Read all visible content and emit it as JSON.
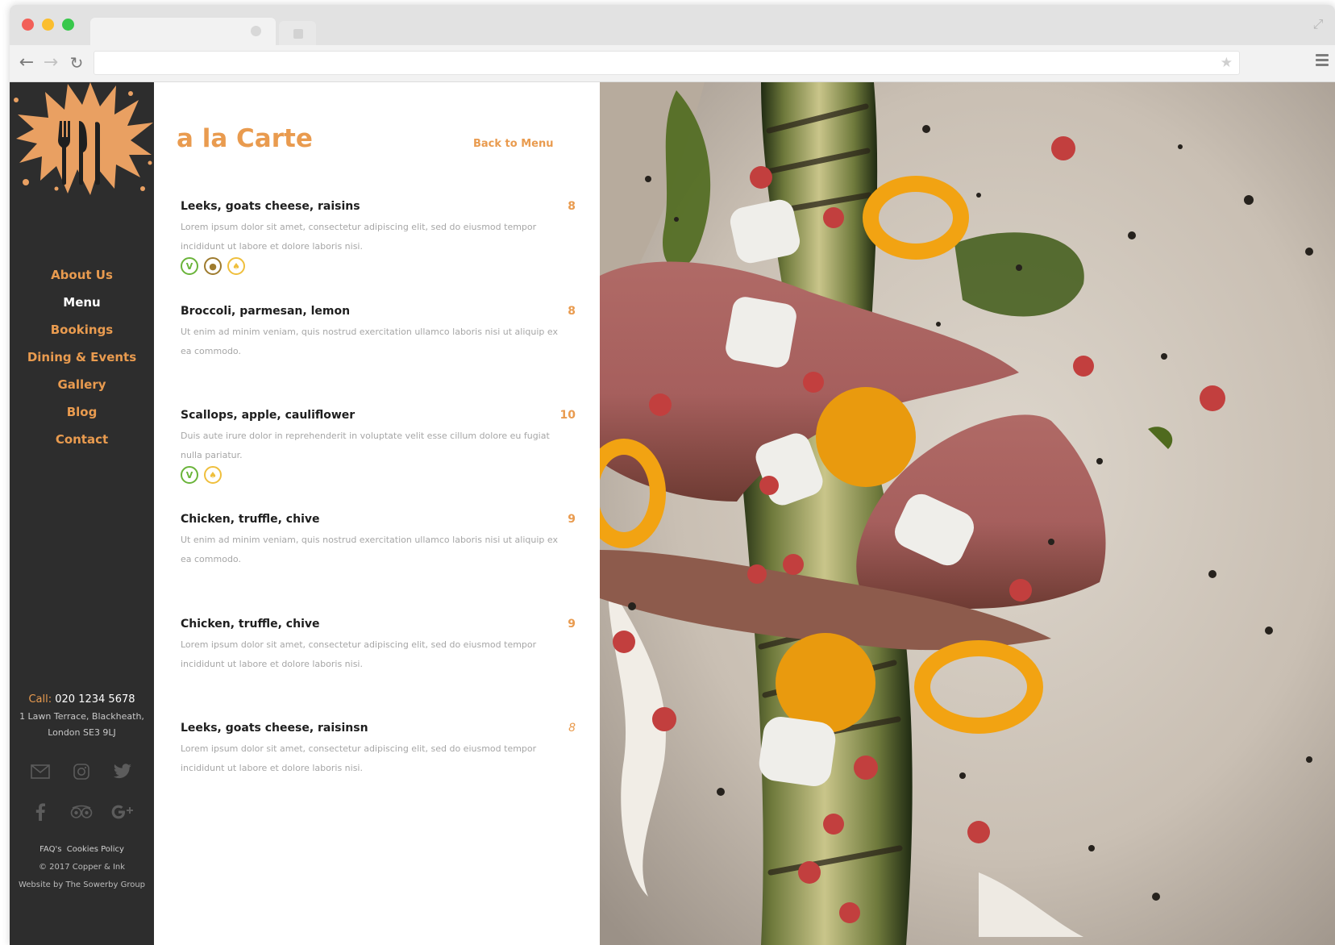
{
  "sidebar": {
    "nav_items": [
      {
        "label": "About Us"
      },
      {
        "label": "Menu"
      },
      {
        "label": "Bookings"
      },
      {
        "label": "Dining & Events"
      },
      {
        "label": "Gallery"
      },
      {
        "label": "Blog"
      },
      {
        "label": "Contact"
      }
    ],
    "current_item": "Menu",
    "call_label": "Call:",
    "phone": "020 1234 5678",
    "address_line1": "1 Lawn Terrace, Blackheath,",
    "address_line2": "London SE3 9LJ",
    "social_icons": [
      "envelope-icon",
      "instagram-icon",
      "twitter-icon",
      "facebook-icon",
      "tripadvisor-icon",
      "google-plus-icon"
    ],
    "footer_faqs": "FAQ's",
    "footer_cookies": "Cookies Policy",
    "copyright": "© 2017 Copper & Ink",
    "credit": "Website by The Sowerby Group"
  },
  "content": {
    "title": "a la Carte",
    "back_link": "Back to Menu",
    "dishes": [
      {
        "name": "Leeks, goats cheese, raisins",
        "price": "8",
        "description": "Lorem ipsum dolor sit amet, consectetur adipiscing elit, sed do eiusmod tempor incididunt ut labore et dolore laboris nisi.",
        "icons": [
          "vegetarian-icon",
          "nut-icon",
          "gluten-icon"
        ]
      },
      {
        "name": "Broccoli, parmesan, lemon",
        "price": "8",
        "description": "Ut enim ad minim veniam, quis nostrud exercitation ullamco laboris nisi ut aliquip ex ea commodo.",
        "icons": []
      },
      {
        "name": "Scallops, apple, cauliflower",
        "price": "10",
        "description": "Duis aute irure dolor in reprehenderit in voluptate velit esse cillum dolore eu fugiat nulla pariatur.",
        "icons": [
          "vegetarian-icon",
          "gluten-icon"
        ]
      },
      {
        "name": "Chicken, truffle, chive",
        "price": "9",
        "description": "Ut enim ad minim veniam, quis nostrud exercitation ullamco laboris nisi ut aliquip ex ea commodo.",
        "icons": []
      },
      {
        "name": "Chicken, truffle, chive",
        "price": "9",
        "description": "Lorem ipsum dolor sit amet, consectetur adipiscing elit, sed do eiusmod tempor incididunt ut labore et dolore laboris nisi.",
        "icons": []
      },
      {
        "name": "Leeks, goats cheese, raisinsn",
        "price": "8",
        "description": "Lorem ipsum dolor sit amet, consectetur adipiscing elit, sed do eiusmod tempor incididunt ut labore et dolore laboris nisi.",
        "icons": []
      }
    ]
  },
  "colors": {
    "accent": "#e99b4f",
    "sidebar_bg": "#2d2d2d",
    "veg_green": "#6ab43a",
    "nut_brown": "#9e7b2e",
    "gluten_yellow": "#efbf3d"
  },
  "browser": {
    "icons": [
      "back-arrow-icon",
      "forward-arrow-icon",
      "reload-icon",
      "bookmark-star-icon",
      "hamburger-menu-icon",
      "expand-icon"
    ]
  }
}
